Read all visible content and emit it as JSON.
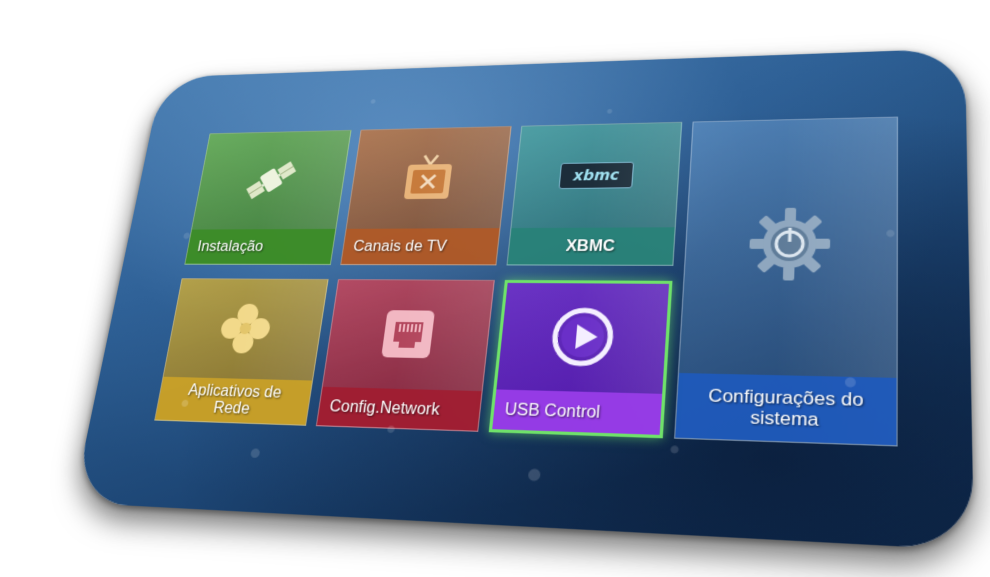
{
  "menu": {
    "tiles": [
      {
        "id": "instalacao",
        "label": "Instalação",
        "icon": "satellite-icon"
      },
      {
        "id": "canais",
        "label": "Canais de TV",
        "icon": "tv-icon"
      },
      {
        "id": "xbmc",
        "label": "XBMC",
        "icon": "xbmc-logo"
      },
      {
        "id": "config",
        "label": "Configurações do sistema",
        "icon": "power-gear-icon"
      },
      {
        "id": "apps",
        "label": "Aplicativos de Rede",
        "icon": "clover-icon"
      },
      {
        "id": "net",
        "label": "Config.Network",
        "icon": "ethernet-port-icon"
      },
      {
        "id": "usb",
        "label": "USB Control",
        "icon": "play-circle-icon",
        "selected": true
      }
    ],
    "xbmc_logo_text": "xbmc"
  },
  "colors": {
    "selection": "#6fe26a",
    "instalacao": "#3c8c28",
    "canais": "#af5a28",
    "xbmc": "#288278",
    "apps": "#c8a028",
    "net": "#a01e32",
    "usb": "#963ce6",
    "config": "#1e5abe"
  }
}
